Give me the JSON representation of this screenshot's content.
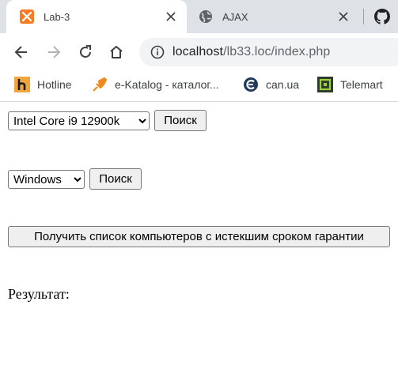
{
  "browser": {
    "tabs": [
      {
        "title": "Lab-3",
        "icon": "xampp-icon",
        "active": true
      },
      {
        "title": "AJAX",
        "icon": "globe-icon",
        "active": false
      }
    ],
    "address": {
      "host": "localhost",
      "path": "/lb33.loc/index.php"
    },
    "bookmarks": [
      {
        "label": "Hotline",
        "icon": "hotline-icon"
      },
      {
        "label": "e-Katalog - каталог...",
        "icon": "ekatalog-icon"
      },
      {
        "label": "can.ua",
        "icon": "can-ua-icon"
      },
      {
        "label": "Telemart",
        "icon": "telemart-icon"
      }
    ],
    "colors": {
      "tabstrip": "#dee1e6",
      "omnibox": "#f1f3f4",
      "xampp": "#fb7a24"
    }
  },
  "content": {
    "cpu_select": {
      "selected": "Intel Core i9 12900k"
    },
    "cpu_search_button": "Поиск",
    "os_select": {
      "selected": "Windows"
    },
    "os_search_button": "Поиск",
    "warranty_button": "Получить список компьютеров с истекшим сроком гарантии",
    "result_label": "Результат:"
  }
}
